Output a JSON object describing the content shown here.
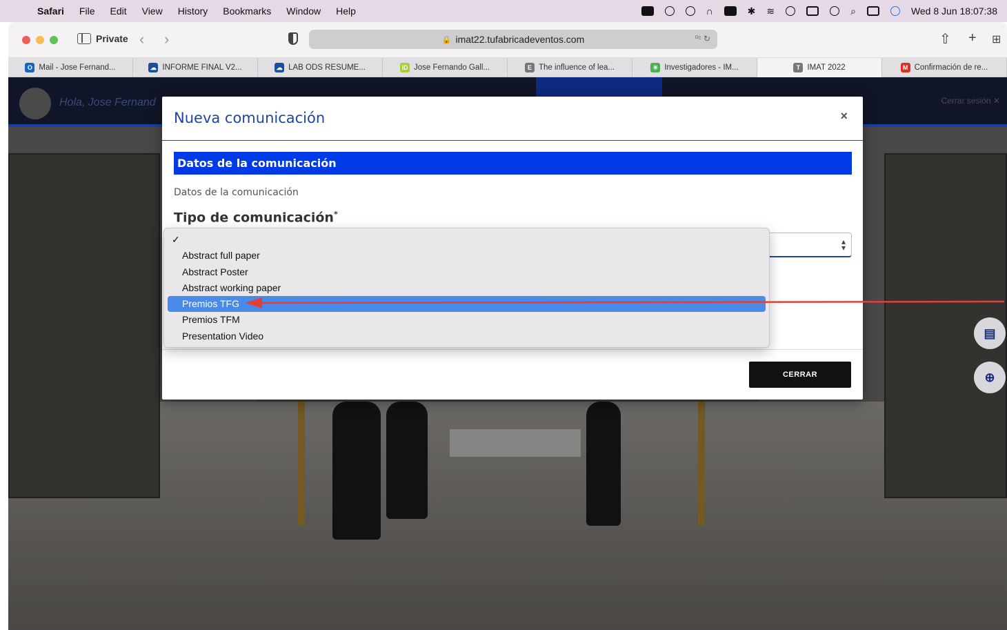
{
  "menubar": {
    "apple": "",
    "app": "Safari",
    "items": [
      "File",
      "Edit",
      "View",
      "History",
      "Bookmarks",
      "Window",
      "Help"
    ],
    "datetime": "Wed 8 Jun  18:07:38"
  },
  "toolbar": {
    "private_label": "Private",
    "url": "imat22.tufabricadeventos.com",
    "url_extra": "⁰ᶜ ↻"
  },
  "tabs": [
    {
      "label": "Mail - Jose Fernand...",
      "icon": "outlook-icon",
      "color": "#1565c0",
      "glyph": "O"
    },
    {
      "label": "INFORME FINAL V2...",
      "icon": "cloud-icon",
      "color": "#1a4fa0",
      "glyph": "☁"
    },
    {
      "label": "LAB ODS RESUME...",
      "icon": "cloud-icon",
      "color": "#1a4fa0",
      "glyph": "☁"
    },
    {
      "label": "Jose Fernando Gall...",
      "icon": "orcid-icon",
      "color": "#a6ce39",
      "glyph": "iD"
    },
    {
      "label": "The influence of lea...",
      "icon": "elsevier-icon",
      "color": "#777",
      "glyph": "E"
    },
    {
      "label": "Investigadores - IM...",
      "icon": "sparkle-icon",
      "color": "#4caf50",
      "glyph": "✳"
    },
    {
      "label": "IMAT 2022",
      "icon": "tab-t-icon",
      "color": "#777",
      "glyph": "T"
    },
    {
      "label": "Confirmación de re...",
      "icon": "gmail-icon",
      "color": "#d93025",
      "glyph": "M"
    }
  ],
  "page": {
    "greeting": "Hola, Jose Fernand",
    "logout": "Cerrar sesión ✕"
  },
  "modal": {
    "title": "Nueva comunicación",
    "close": "×",
    "section_title": "Datos de la comunicación",
    "section_subtitle": "Datos de la comunicación",
    "field_label": "Tipo de comunicación",
    "required_mark": "*",
    "close_button": "CERRAR"
  },
  "dropdown": {
    "options": [
      {
        "label": "",
        "checked": true
      },
      {
        "label": "Abstract full paper"
      },
      {
        "label": "Abstract Poster"
      },
      {
        "label": "Abstract working paper"
      },
      {
        "label": "Premios TFG",
        "highlighted": true
      },
      {
        "label": "Premios TFM"
      },
      {
        "label": "Presentation Video"
      }
    ]
  },
  "colors": {
    "accent": "#0039e6",
    "highlight": "#4a8ae8",
    "annotation": "#e0403a"
  }
}
